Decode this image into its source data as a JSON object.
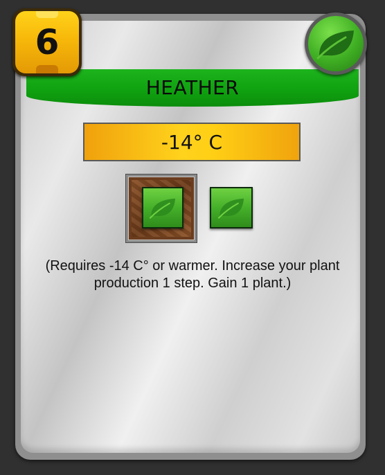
{
  "card": {
    "title": "HEATHER",
    "cost": "6",
    "tag_icon": "plant-leaf-icon",
    "requirement": "-14° C",
    "production": {
      "tile_icon": "plant-leaf-icon"
    },
    "gain": {
      "tile_icon": "plant-leaf-icon"
    },
    "description": "(Requires -14 C° or warmer. Increase your plant production 1 step. Gain 1 plant.)"
  },
  "colors": {
    "title_bar": "#12a812",
    "cost_badge": "#f7b80a",
    "requirement_box": "#ffd21c",
    "plant_tile": "#45b02a",
    "production_bg": "#6e3c1a"
  }
}
